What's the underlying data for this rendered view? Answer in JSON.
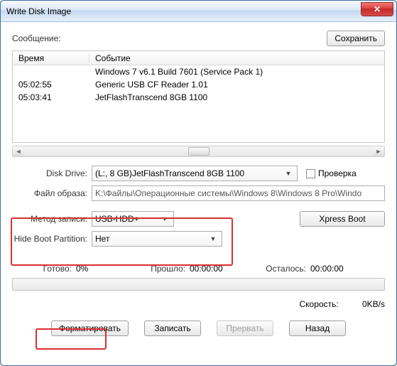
{
  "window": {
    "title": "Write Disk Image"
  },
  "labels": {
    "message": "Сообщение:",
    "save": "Сохранить",
    "col_time": "Время",
    "col_event": "Событие",
    "disk_drive": "Disk Drive:",
    "check": "Проверка",
    "image_file": "Файл образа:",
    "write_method": "Метод записи:",
    "hide_boot": "Hide Boot Partition:",
    "xpress_boot": "Xpress Boot",
    "ready": "Готово:",
    "elapsed": "Прошло:",
    "remaining": "Осталось:",
    "speed": "Скорость:",
    "format": "Форматировать",
    "write": "Записать",
    "abort": "Прервать",
    "back": "Назад"
  },
  "log": {
    "rows": [
      {
        "time": "",
        "event": "Windows 7 v6.1 Build 7601 (Service Pack 1)"
      },
      {
        "time": "05:02:55",
        "event": "Generic USB CF Reader   1.01"
      },
      {
        "time": "05:03:41",
        "event": "JetFlashTranscend 8GB   1100"
      }
    ]
  },
  "fields": {
    "disk_drive": "(L:, 8 GB)JetFlashTranscend 8GB   1100",
    "image_file": "K:\\Файлы\\Операционные системы\\Windows 8\\Windows 8 Pro\\Windo",
    "write_method": "USB-HDD+",
    "hide_boot": "Нет"
  },
  "status": {
    "percent": "0%",
    "elapsed": "00:00:00",
    "remaining": "00:00:00",
    "speed": "0KB/s"
  }
}
